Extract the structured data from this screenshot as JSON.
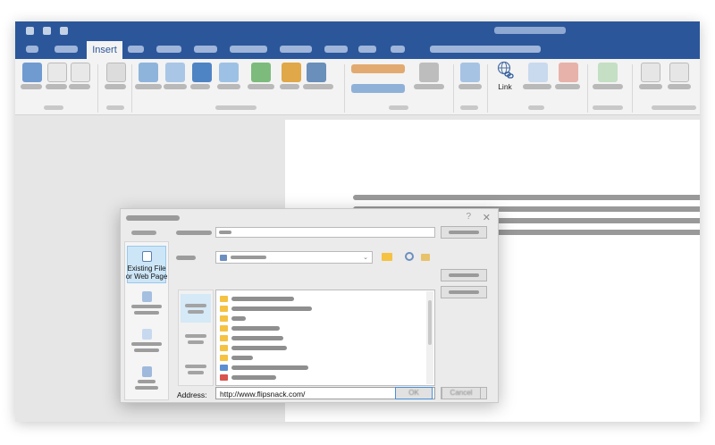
{
  "ribbon": {
    "active_tab": "Insert",
    "link_button": "Link"
  },
  "dialog": {
    "link_to_options": [
      "Existing File\nor Web Page"
    ],
    "address_label": "Address:",
    "address_value": "http://www.flipsnack.com/",
    "ok_button": "OK",
    "cancel_button": "Cancel"
  },
  "colors": {
    "accent": "#2b579a",
    "selected_nav": "#cde6f7",
    "folder": "#f5c242"
  },
  "icons": {
    "link": "globe-chain-icon",
    "existing_file": "document-globe-icon",
    "folder": "folder-icon"
  }
}
